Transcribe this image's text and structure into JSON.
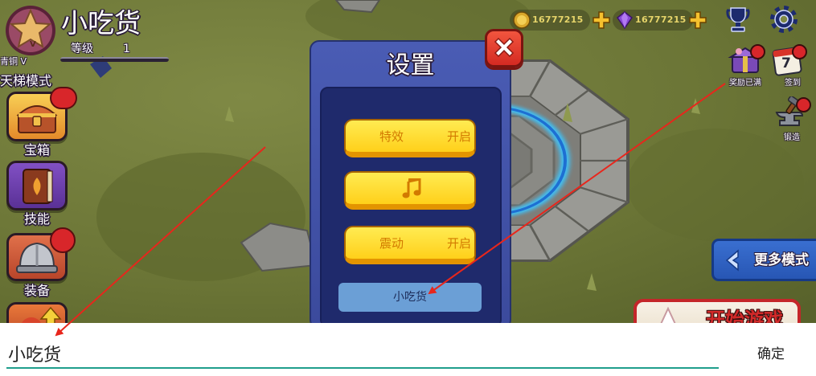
{
  "player": {
    "name": "小吃货",
    "rank_badge": "V",
    "level_label": "等级",
    "level": "1",
    "rank": "青铜 V",
    "mode": "天梯模式",
    "avatar_icon": "rank-star-icon"
  },
  "currency": {
    "coins": "16777215",
    "coin_icon": "gold-coin-icon",
    "gems": "16777215",
    "gem_icon": "purple-gem-icon",
    "add_icon": "plus-icon"
  },
  "top_icons": [
    "trophy-icon",
    "gear-icon"
  ],
  "left_menu": [
    {
      "label": "宝箱",
      "icon": "treasure-chest-icon"
    },
    {
      "label": "技能",
      "icon": "skill-book-icon"
    },
    {
      "label": "装备",
      "icon": "helmet-icon"
    },
    {
      "icon": "upgrade-arrow-icon"
    }
  ],
  "right_menu": [
    {
      "label": "奖励已满",
      "icon": "gift-chest-icon"
    },
    {
      "label": "签到",
      "icon": "calendar-icon",
      "day": "7"
    },
    {
      "label": "锻造",
      "icon": "anvil-icon"
    }
  ],
  "more_modes": {
    "label": "更多模式",
    "icon": "chevron-left-icon"
  },
  "start_game": {
    "label": "开始游戏"
  },
  "settings": {
    "title": "设置",
    "close_icon": "close-icon",
    "effects": {
      "label": "特效",
      "state": "开启"
    },
    "music": {
      "icon": "music-note-icon"
    },
    "vibration": {
      "label": "震动",
      "state": "开启"
    },
    "player_name": "小吃货"
  },
  "name_input": {
    "value": "小吃货",
    "confirm_label": "确定"
  },
  "colors": {
    "ground": "#6b7536",
    "panel": "#3d4ea0",
    "panel_inner": "#1f2a6c",
    "button_yellow": "#ffd426",
    "button_text": "#d27a00",
    "close_red": "#e2372a",
    "name_field": "#6b9fd6",
    "input_underline": "#1f9e8c",
    "annotation_red": "#e8261c"
  }
}
